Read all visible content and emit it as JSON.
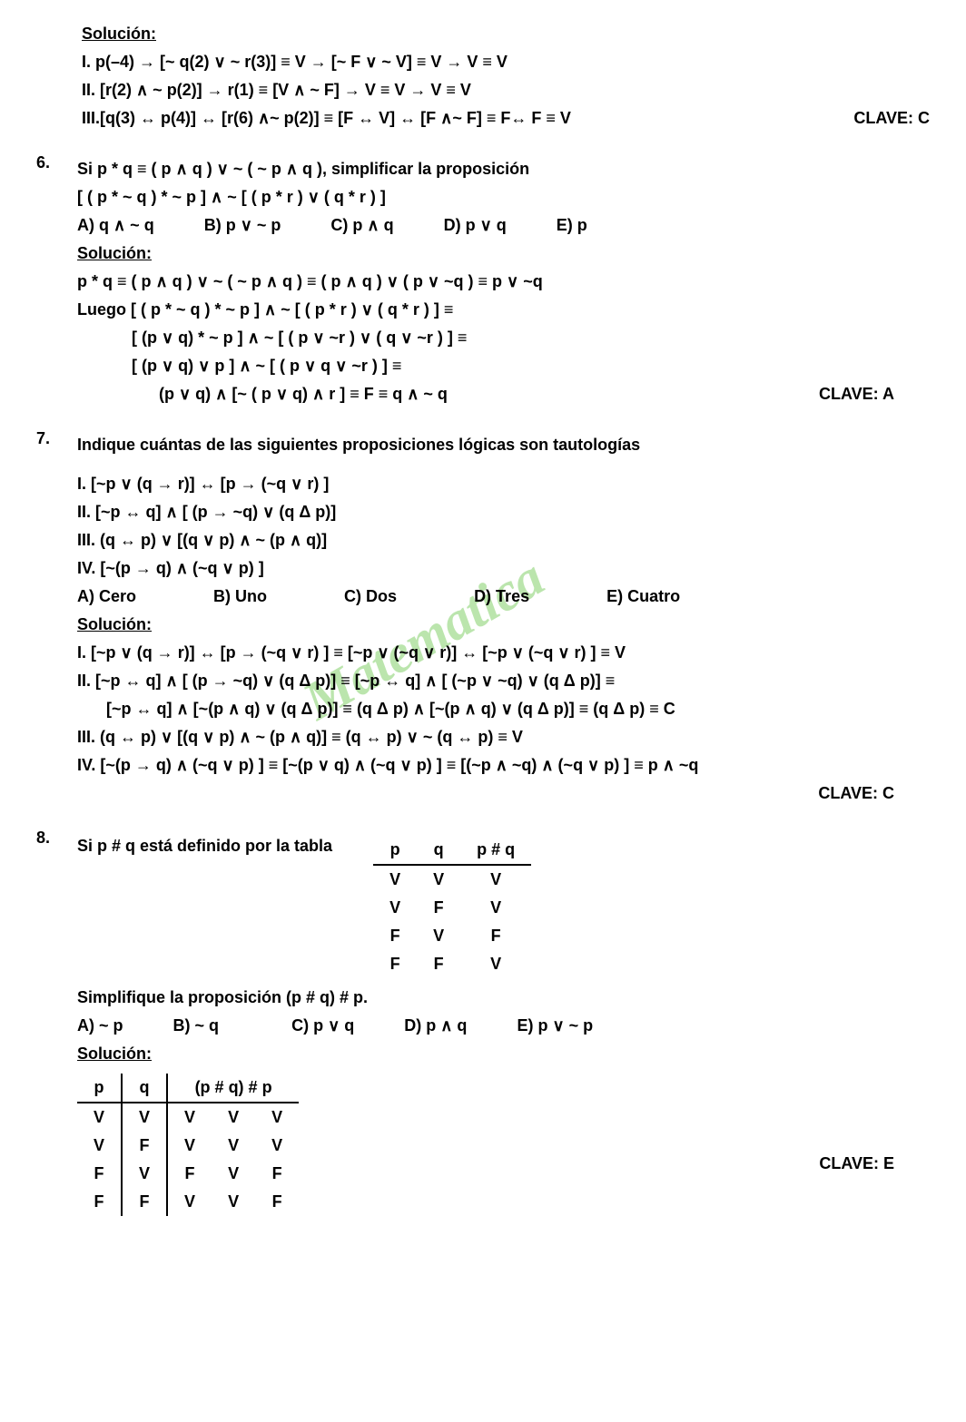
{
  "watermark": "Matematica",
  "top": {
    "sol_label": "Solución:",
    "i": "I.  p(–4) → [~ q(2) ∨ ~ r(3)] ≡  V → [~ F ∨ ~ V] ≡  V → V ≡ V",
    "ii": "II. [r(2) ∧ ~ p(2)] → r(1) ≡ [V ∧ ~ F] → V ≡ V → V ≡ V",
    "iii": "III.[q(3) ↔ p(4)] ↔ [r(6) ∧~ p(2)] ≡ [F ↔ V] ↔ [F ∧~ F] ≡ F↔ F ≡ V",
    "clave": "CLAVE: C"
  },
  "q6": {
    "num": "6.",
    "prompt1": "Si  p * q ≡ ( p ∧ q ) ∨ ~ (  ~ p ∧ q ), simplificar la proposición",
    "prompt2": "[ ( p * ~ q ) * ~ p ] ∧ ~ [ ( p * r ) ∨ ( q * r ) ]",
    "opts": {
      "a": "A) q ∧ ~ q",
      "b": "B) p ∨ ~ p",
      "c": "C) p ∧ q",
      "d": "D) p ∨ q",
      "e": "E) p"
    },
    "sol_label": "Solución:",
    "s1": "p * q ≡ ( p ∧ q ) ∨ ~ (  ~ p ∧ q ) ≡ ( p ∧ q ) ∨ ( p ∨ ~q ) ≡  p ∨ ~q",
    "s2": "Luego [ ( p * ~ q ) * ~ p ] ∧ ~ [ ( p * r ) ∨ ( q * r ) ] ≡",
    "s3": "[ (p ∨ q) * ~ p ] ∧ ~ [ ( p ∨ ~r ) ∨ ( q ∨ ~r ) ] ≡",
    "s4": "[ (p ∨ q) ∨ p ] ∧ ~ [ (  p ∨ q ∨ ~r ) ] ≡",
    "s5": "(p ∨ q)    ∧ [~ ( p ∨ q) ∧ r ] ≡ F ≡ q ∧ ~ q",
    "clave": "CLAVE: A"
  },
  "q7": {
    "num": "7.",
    "prompt": "Indique cuántas de las siguientes proposiciones lógicas son tautologías",
    "i": "I.   [~p ∨ (q → r)] ↔ [p → (~q ∨ r) ]",
    "ii": "II.  [~p ↔ q] ∧ [ (p → ~q) ∨ (q Δ p)]",
    "iii": "III. (q ↔ p) ∨ [(q ∨ p) ∧ ~ (p ∧ q)]",
    "iv": "IV. [~(p → q) ∧ (~q ∨ p)  ]",
    "opts": {
      "a": "A) Cero",
      "b": "B) Uno",
      "c": "C) Dos",
      "d": "D) Tres",
      "e": "E) Cuatro"
    },
    "sol_label": "Solución:",
    "s1": "I.   [~p ∨ (q → r)] ↔ [p → (~q ∨ r) ] ≡ [~p ∨ (~q ∨ r)] ↔ [~p ∨ (~q ∨ r) ] ≡ V",
    "s2": "II.  [~p ↔ q] ∧ [ (p → ~q) ∨ (q Δ p)] ≡ [~p ↔ q] ∧ [ (~p ∨  ~q) ∨ (q Δ p)] ≡",
    "s2b": "[~p ↔ q] ∧ [~(p ∧ q) ∨ (q Δ p)] ≡ (q Δ p) ∧ [~(p ∧ q) ∨ (q Δ p)] ≡ (q Δ p) ≡ C",
    "s3": "III. (q ↔ p) ∨ [(q ∨ p) ∧ ~ (p ∧ q)] ≡ (q ↔ p) ∨ ~ (q ↔ p)  ≡ V",
    "s4": "IV. [~(p → q) ∧ (~q ∨ p)  ] ≡ [~(p ∨ q) ∧ (~q ∨ p) ] ≡ [(~p ∧ ~q) ∧ (~q ∨ p) ]  ≡ p ∧ ~q",
    "clave": "CLAVE: C"
  },
  "q8": {
    "num": "8.",
    "prompt": "Si  p # q  está definido por la tabla",
    "th": {
      "p": "p",
      "q": "q",
      "pq": "p # q"
    },
    "rows": [
      [
        "V",
        "V",
        "V"
      ],
      [
        "V",
        "F",
        "V"
      ],
      [
        "F",
        "V",
        "F"
      ],
      [
        "F",
        "F",
        "V"
      ]
    ],
    "prompt2": "Simplifique la proposición  (p # q) # p.",
    "opts": {
      "a": "A) ~ p",
      "b": "B) ~ q",
      "c": "C) p ∨ q",
      "d": "D) p ∧ q",
      "e": "E) p ∨ ~ p"
    },
    "sol_label": "Solución:",
    "th2": {
      "p": "p",
      "q": "q",
      "pq": "(p # q) #  p"
    },
    "rows2": [
      [
        "V",
        "V",
        "V",
        "V",
        "V"
      ],
      [
        "V",
        "F",
        "V",
        "V",
        "V"
      ],
      [
        "F",
        "V",
        "F",
        "V",
        "F"
      ],
      [
        "F",
        "F",
        "V",
        "V",
        "F"
      ]
    ],
    "clave": "CLAVE: E"
  }
}
